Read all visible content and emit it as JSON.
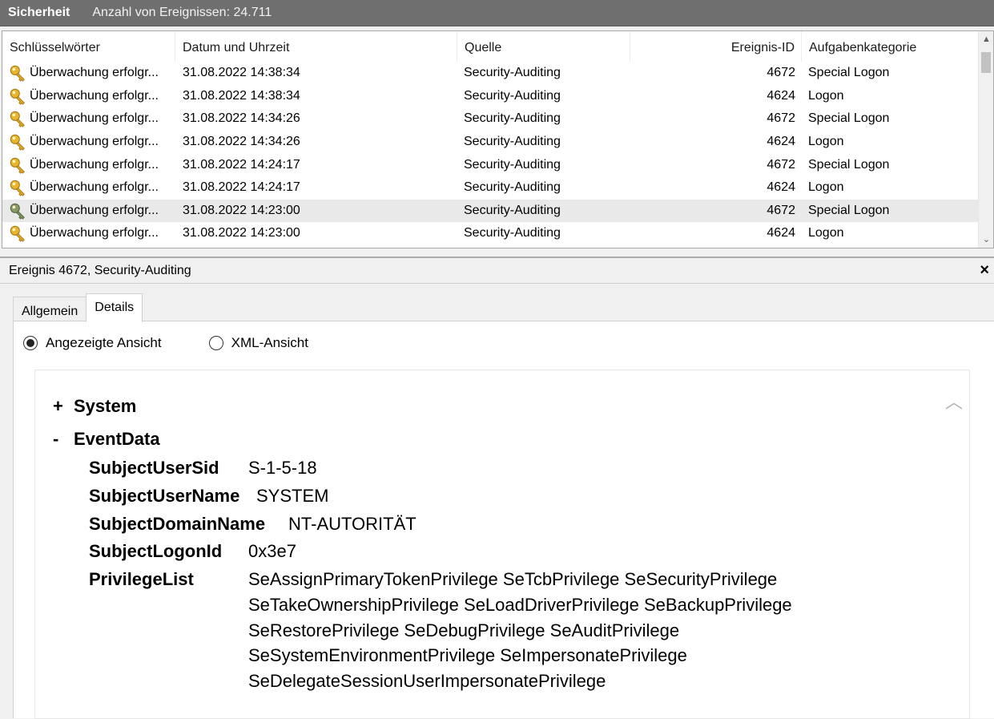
{
  "titlebar": {
    "title": "Sicherheit",
    "count": "Anzahl von Ereignissen: 24.711"
  },
  "list": {
    "columns": [
      "Schlüsselwörter",
      "Datum und Uhrzeit",
      "Quelle",
      "Ereignis-ID",
      "Aufgabenkategorie"
    ],
    "rows": [
      {
        "keyword": "Überwachung erfolgr...",
        "datetime": "31.08.2022 14:38:34",
        "source": "Security-Auditing",
        "id": "4672",
        "category": "Special Logon"
      },
      {
        "keyword": "Überwachung erfolgr...",
        "datetime": "31.08.2022 14:38:34",
        "source": "Security-Auditing",
        "id": "4624",
        "category": "Logon"
      },
      {
        "keyword": "Überwachung erfolgr...",
        "datetime": "31.08.2022 14:34:26",
        "source": "Security-Auditing",
        "id": "4672",
        "category": "Special Logon"
      },
      {
        "keyword": "Überwachung erfolgr...",
        "datetime": "31.08.2022 14:34:26",
        "source": "Security-Auditing",
        "id": "4624",
        "category": "Logon"
      },
      {
        "keyword": "Überwachung erfolgr...",
        "datetime": "31.08.2022 14:24:17",
        "source": "Security-Auditing",
        "id": "4672",
        "category": "Special Logon"
      },
      {
        "keyword": "Überwachung erfolgr...",
        "datetime": "31.08.2022 14:24:17",
        "source": "Security-Auditing",
        "id": "4624",
        "category": "Logon"
      },
      {
        "keyword": "Überwachung erfolgr...",
        "datetime": "31.08.2022 14:23:00",
        "source": "Security-Auditing",
        "id": "4672",
        "category": "Special Logon"
      },
      {
        "keyword": "Überwachung erfolgr...",
        "datetime": "31.08.2022 14:23:00",
        "source": "Security-Auditing",
        "id": "4624",
        "category": "Logon"
      }
    ],
    "selected_row": 6,
    "key_icon_name": "key-icon"
  },
  "detail": {
    "title": "Ereignis 4672, Security-Auditing",
    "close_glyph": "×",
    "tabs": [
      "Allgemein",
      "Details"
    ],
    "active_tab": "Details",
    "radio_display": "Angezeigte Ansicht",
    "radio_xml": "XML-Ansicht",
    "radio_selected": "Angezeigte Ansicht",
    "system_sym": "+",
    "system_label": "System",
    "eventdata_sym": "-",
    "eventdata_label": "EventData",
    "fields": [
      {
        "name": "SubjectUserSid",
        "value": "S-1-5-18"
      },
      {
        "name": "SubjectUserName",
        "value": "SYSTEM"
      },
      {
        "name": "SubjectDomainName",
        "value": "NT-AUTORITÄT"
      },
      {
        "name": "SubjectLogonId",
        "value": "0x3e7"
      }
    ],
    "privilege_label": "PrivilegeList",
    "privileges": [
      "SeAssignPrimaryTokenPrivilege SeTcbPrivilege SeSecurityPrivilege",
      "SeTakeOwnershipPrivilege SeLoadDriverPrivilege SeBackupPrivilege",
      "SeRestorePrivilege SeDebugPrivilege SeAuditPrivilege",
      "SeSystemEnvironmentPrivilege SeImpersonatePrivilege",
      "SeDelegateSessionUserImpersonatePrivilege"
    ]
  }
}
